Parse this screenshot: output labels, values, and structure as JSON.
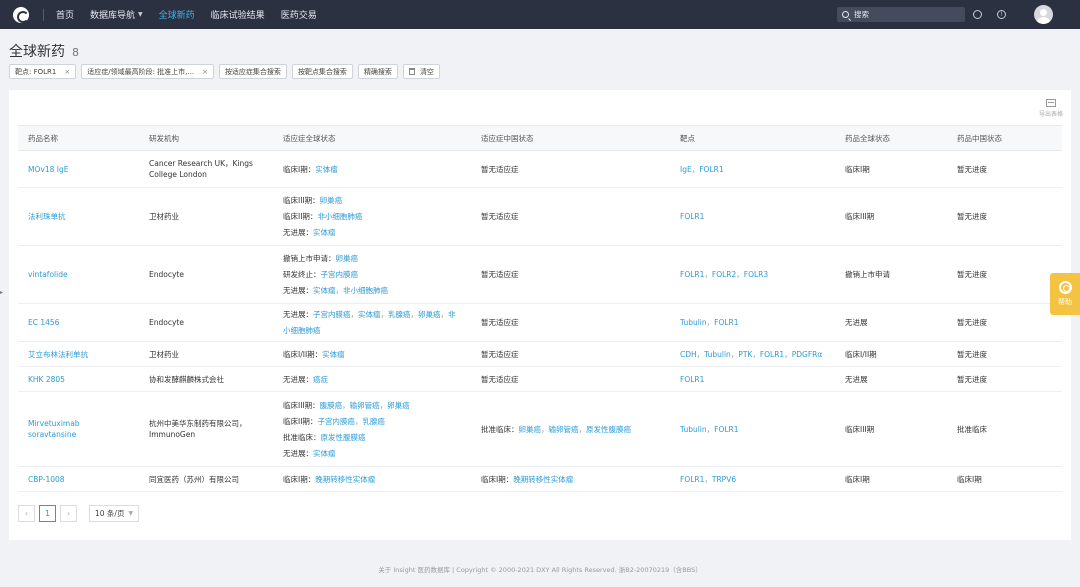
{
  "nav": {
    "items": [
      {
        "label": "首页",
        "active": false,
        "dropdown": false
      },
      {
        "label": "数据库导航",
        "active": false,
        "dropdown": true
      },
      {
        "label": "全球新药",
        "active": true,
        "dropdown": false
      },
      {
        "label": "临床试验结果",
        "active": false,
        "dropdown": false
      },
      {
        "label": "医药交易",
        "active": false,
        "dropdown": false
      }
    ],
    "search_placeholder": "搜索",
    "icons": [
      "logo-icon",
      "search-icon",
      "lightbulb-icon",
      "info-icon",
      "avatar"
    ]
  },
  "page": {
    "title": "全球新药",
    "count": "8"
  },
  "filters": {
    "chips": [
      {
        "label": "靶点: FOLR1",
        "closable": true
      },
      {
        "label": "适应症/领域最高阶段: 批准上市,...",
        "closable": true
      }
    ],
    "buttons": [
      "按适应症集合搜索",
      "按靶点集合搜索",
      "精确搜索",
      "清空"
    ]
  },
  "export_label": "导出表格",
  "table": {
    "columns": [
      "药品名称",
      "研发机构",
      "适应症全球状态",
      "适应症中国状态",
      "靶点",
      "药品全球状态",
      "药品中国状态"
    ],
    "rows": [
      {
        "name": "MOv18 IgE",
        "org": "Cancer Research UK，Kings College London",
        "global_ind": [
          {
            "prefix": "临床I期：",
            "items": [
              "实体瘤"
            ]
          }
        ],
        "cn_ind": [
          {
            "prefix": "暂无适应症",
            "items": []
          }
        ],
        "targets": [
          "IgE",
          "FOLR1"
        ],
        "global_status": "临床I期",
        "cn_status": "暂无进度"
      },
      {
        "name": "法利珠单抗",
        "org": "卫材药业",
        "global_ind": [
          {
            "prefix": "临床III期：",
            "items": [
              "卵巢癌"
            ]
          },
          {
            "prefix": "临床II期：",
            "items": [
              "非小细胞肺癌"
            ]
          },
          {
            "prefix": "无进展：",
            "items": [
              "实体瘤"
            ]
          }
        ],
        "cn_ind": [
          {
            "prefix": "暂无适应症",
            "items": []
          }
        ],
        "targets": [
          "FOLR1"
        ],
        "global_status": "临床III期",
        "cn_status": "暂无进度"
      },
      {
        "name": "vintafolide",
        "org": "Endocyte",
        "global_ind": [
          {
            "prefix": "撤销上市申请：",
            "items": [
              "卵巢癌"
            ]
          },
          {
            "prefix": "研发终止：",
            "items": [
              "子宫内膜癌"
            ]
          },
          {
            "prefix": "无进展：",
            "items": [
              "实体瘤",
              "非小细胞肺癌"
            ]
          }
        ],
        "cn_ind": [
          {
            "prefix": "暂无适应症",
            "items": []
          }
        ],
        "targets": [
          "FOLR1",
          "FOLR2",
          "FOLR3"
        ],
        "global_status": "撤销上市申请",
        "cn_status": "暂无进度"
      },
      {
        "name": "EC 1456",
        "org": "Endocyte",
        "global_ind": [
          {
            "prefix": "无进展：",
            "items": [
              "子宫内膜癌",
              "实体瘤",
              "乳腺癌",
              "卵巢癌",
              "非"
            ]
          },
          {
            "prefix": "",
            "items": [
              "小细胞肺癌"
            ]
          }
        ],
        "cn_ind": [
          {
            "prefix": "暂无适应症",
            "items": []
          }
        ],
        "targets": [
          "Tubulin",
          "FOLR1"
        ],
        "global_status": "无进展",
        "cn_status": "暂无进度"
      },
      {
        "name": "艾立布林法利单抗",
        "org": "卫材药业",
        "global_ind": [
          {
            "prefix": "临床I/II期：",
            "items": [
              "实体瘤"
            ]
          }
        ],
        "cn_ind": [
          {
            "prefix": "暂无适应症",
            "items": []
          }
        ],
        "targets": [
          "CDH",
          "Tubulin",
          "PTK",
          "FOLR1",
          "PDGFRα"
        ],
        "global_status": "临床I/II期",
        "cn_status": "暂无进度"
      },
      {
        "name": "KHK 2805",
        "org": "协和发酵麒麟株式会社",
        "global_ind": [
          {
            "prefix": "无进展：",
            "items": [
              "癌症"
            ]
          }
        ],
        "cn_ind": [
          {
            "prefix": "暂无适应症",
            "items": []
          }
        ],
        "targets": [
          "FOLR1"
        ],
        "global_status": "无进展",
        "cn_status": "暂无进度"
      },
      {
        "name": "Mirvetuximab soravtansine",
        "org": "杭州中美华东制药有限公司，ImmunoGen",
        "global_ind": [
          {
            "prefix": "临床III期：",
            "items": [
              "腹膜癌",
              "输卵管癌",
              "卵巢癌"
            ]
          },
          {
            "prefix": "临床II期：",
            "items": [
              "子宫内膜癌",
              "乳腺癌"
            ]
          },
          {
            "prefix": "批准临床：",
            "items": [
              "原发性腹膜癌"
            ]
          },
          {
            "prefix": "无进展：",
            "items": [
              "实体瘤"
            ]
          }
        ],
        "cn_ind": [
          {
            "prefix": "批准临床：",
            "items": [
              "卵巢癌",
              "输卵管癌",
              "原发性腹膜癌"
            ]
          }
        ],
        "targets": [
          "Tubulin",
          "FOLR1"
        ],
        "global_status": "临床III期",
        "cn_status": "批准临床"
      },
      {
        "name": "CBP-1008",
        "org": "同宜医药（苏州）有限公司",
        "global_ind": [
          {
            "prefix": "临床I期：",
            "items": [
              "晚期转移性实体瘤"
            ]
          }
        ],
        "cn_ind": [
          {
            "prefix": "临床I期：",
            "items": [
              "晚期转移性实体瘤"
            ]
          }
        ],
        "targets": [
          "FOLR1",
          "TRPV6"
        ],
        "global_status": "临床I期",
        "cn_status": "临床I期"
      }
    ]
  },
  "pagination": {
    "prev": "‹",
    "current": "1",
    "next": "›",
    "page_size": "10 条/页"
  },
  "footer": "关于 Insight 医药数据库  |  Copyright © 2000-2021 DXY All Rights Reserved. 浙B2-20070219（含BBS）",
  "help_label": "帮助",
  "colors": {
    "nav_bg": "#2c3142",
    "accent": "#2b9bd6",
    "help_bg": "#f5c342"
  }
}
